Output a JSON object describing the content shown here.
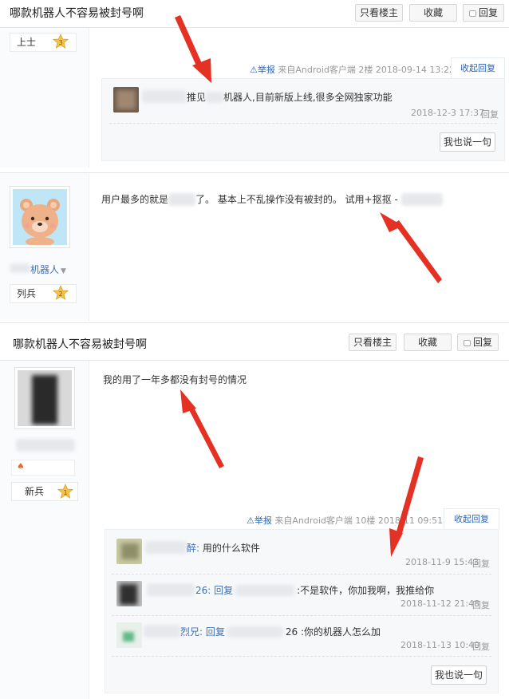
{
  "colors": {
    "accent_link": "#2d64b3",
    "arrow_red": "#e53124",
    "meta_gray": "#999999"
  },
  "thread1": {
    "title": "哪款机器人不容易被封号啊",
    "btn_only_op": "只看楼主",
    "btn_collect": "收藏",
    "btn_reply": "回复",
    "rank": "上士",
    "rank_level": "3",
    "meta": {
      "report": "举报",
      "source": "来自Android客户端",
      "floor": "2楼",
      "time": "2018-09-14 13:22",
      "collapse": "收起回复"
    },
    "comments": [
      {
        "text": "推见",
        "text2": "机器人,目前新版上线,很多全网独家功能",
        "time": "2018-12-3 17:37",
        "reply": "回复"
      }
    ],
    "say_button": "我也说一句"
  },
  "post2": {
    "username_suffix": "机器人",
    "rank": "列兵",
    "rank_level": "2",
    "text_a": "用户最多的就是",
    "text_b": "了。 基本上不乱操作没有被封的。 试用+抠抠 -"
  },
  "thread2": {
    "title": "哪款机器人不容易被封号啊",
    "btn_only_op": "只看楼主",
    "btn_collect": "收藏",
    "btn_reply": "回复",
    "post_text": "我的用了一年多都没有封号的情况",
    "rank": "新兵",
    "rank_level": "1",
    "meta": {
      "report": "举报",
      "source": "来自Android客户端",
      "floor": "10楼",
      "time": "2018-11",
      "time_tail": "09:51",
      "collapse": "收起回复"
    },
    "comments": [
      {
        "name_tail": "醉:",
        "text": "用的什么软件",
        "time": "2018-11-9 15:43",
        "reply": "回复"
      },
      {
        "name_tail": "26: 回复",
        "text": ":不是软件，你加我啊，我推给你",
        "time": "2018-11-12 21:48",
        "reply": "回复"
      },
      {
        "name_tail": "烈兄: 回复",
        "text": "26 :你的机器人怎么加",
        "time": "2018-11-13 10:40",
        "reply": "回复"
      }
    ],
    "say_button": "我也说一句"
  }
}
